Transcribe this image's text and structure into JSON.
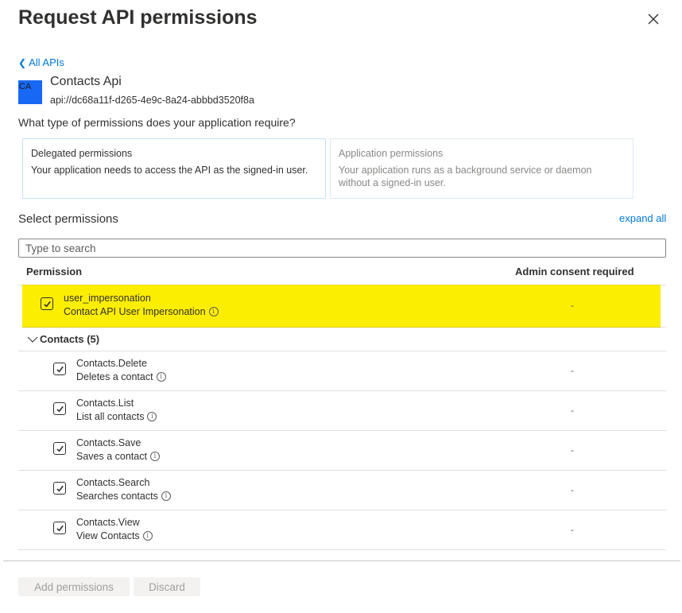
{
  "header": {
    "title": "Request API permissions",
    "close_icon": "close-icon"
  },
  "back_link": {
    "label": "All APIs",
    "icon": "chevron-left-icon"
  },
  "api": {
    "avatar_initials": "CA",
    "avatar_color": "#1768f4",
    "name": "Contacts Api",
    "uri": "api://dc68a11f-d265-4e9c-8a24-abbbd3520f8a"
  },
  "permission_type": {
    "question": "What type of permissions does your application require?",
    "options": [
      {
        "title": "Delegated permissions",
        "description": "Your application needs to access the API as the signed-in user.",
        "selected": true
      },
      {
        "title": "Application permissions",
        "description": "Your application runs as a background service or daemon without a signed-in user.",
        "selected": false
      }
    ]
  },
  "select_permissions": {
    "label": "Select permissions",
    "expand_all": "expand all",
    "search_placeholder": "Type to search",
    "search_value": ""
  },
  "table": {
    "columns": [
      "Permission",
      "Admin consent required"
    ],
    "highlight_color": "#fcee00",
    "top_rows": [
      {
        "name": "user_impersonation",
        "description": "Contact API User Impersonation",
        "admin_consent": "-",
        "checked": true,
        "highlighted": true
      }
    ],
    "groups": [
      {
        "label": "Contacts (5)",
        "expanded": true,
        "rows": [
          {
            "name": "Contacts.Delete",
            "description": "Deletes a contact",
            "admin_consent": "-",
            "checked": true
          },
          {
            "name": "Contacts.List",
            "description": "List all contacts",
            "admin_consent": "-",
            "checked": true
          },
          {
            "name": "Contacts.Save",
            "description": "Saves a contact",
            "admin_consent": "-",
            "checked": true
          },
          {
            "name": "Contacts.Search",
            "description": "Searches contacts",
            "admin_consent": "-",
            "checked": true
          },
          {
            "name": "Contacts.View",
            "description": "View Contacts",
            "admin_consent": "-",
            "checked": true
          }
        ]
      }
    ]
  },
  "footer": {
    "add_label": "Add permissions",
    "discard_label": "Discard"
  },
  "colors": {
    "link": "#0078d4",
    "text": "#323130",
    "disabled_button_bg": "#f3f2f1"
  }
}
